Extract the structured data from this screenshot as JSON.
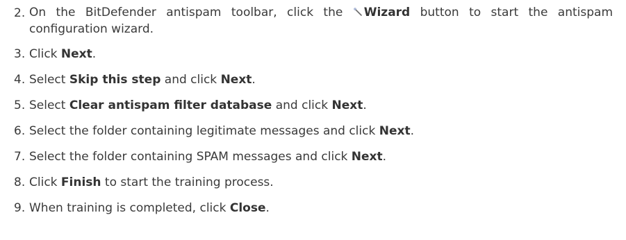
{
  "steps": [
    {
      "number": "2.",
      "parts": [
        {
          "t": "On the BitDefender antispam toolbar, click the "
        },
        {
          "icon": "wand-icon"
        },
        {
          "t": "Wizard",
          "b": true
        },
        {
          "t": " button to start the antispam configuration wizard."
        }
      ]
    },
    {
      "number": "3.",
      "parts": [
        {
          "t": "Click "
        },
        {
          "t": "Next",
          "b": true
        },
        {
          "t": "."
        }
      ]
    },
    {
      "number": "4.",
      "parts": [
        {
          "t": "Select "
        },
        {
          "t": "Skip this step",
          "b": true
        },
        {
          "t": " and click "
        },
        {
          "t": "Next",
          "b": true
        },
        {
          "t": "."
        }
      ]
    },
    {
      "number": "5.",
      "parts": [
        {
          "t": "Select "
        },
        {
          "t": "Clear antispam filter database",
          "b": true
        },
        {
          "t": " and click "
        },
        {
          "t": "Next",
          "b": true
        },
        {
          "t": "."
        }
      ]
    },
    {
      "number": "6.",
      "parts": [
        {
          "t": "Select the folder containing legitimate messages and click "
        },
        {
          "t": "Next",
          "b": true
        },
        {
          "t": "."
        }
      ]
    },
    {
      "number": "7.",
      "parts": [
        {
          "t": "Select the folder containing SPAM messages and click "
        },
        {
          "t": "Next",
          "b": true
        },
        {
          "t": "."
        }
      ]
    },
    {
      "number": "8.",
      "parts": [
        {
          "t": "Click "
        },
        {
          "t": "Finish",
          "b": true
        },
        {
          "t": " to start the training process."
        }
      ]
    },
    {
      "number": "9.",
      "parts": [
        {
          "t": "When training is completed, click "
        },
        {
          "t": "Close",
          "b": true
        },
        {
          "t": "."
        }
      ]
    }
  ]
}
